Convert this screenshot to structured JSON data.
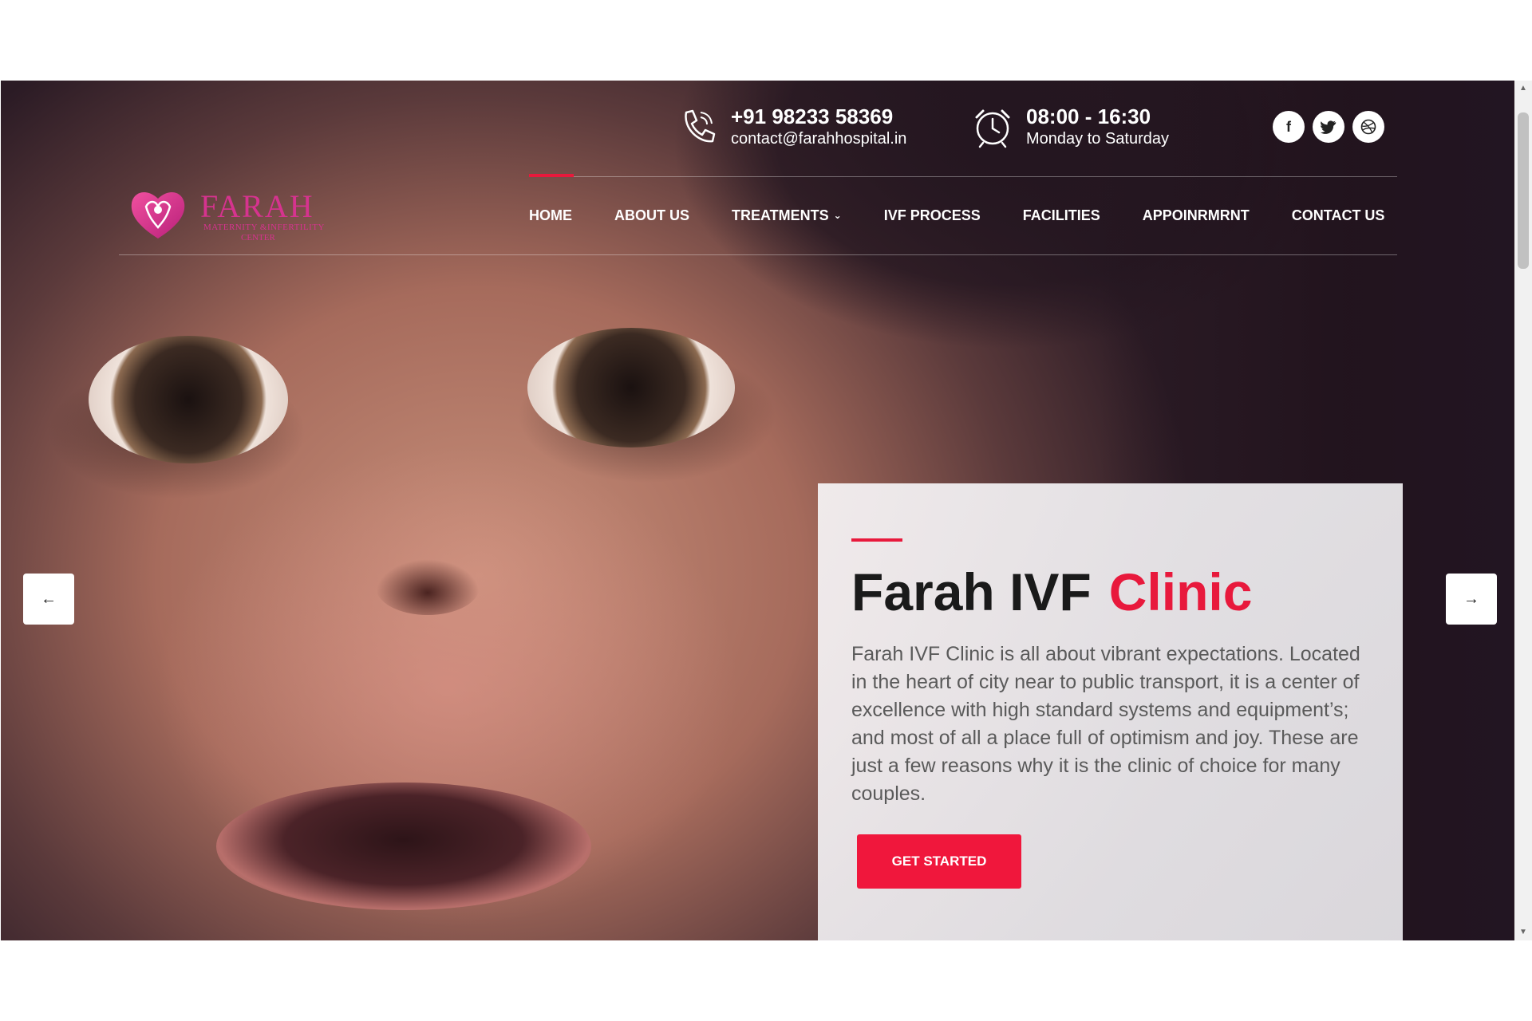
{
  "header": {
    "phone": "+91 98233 58369",
    "email": "contact@farahhospital.in",
    "hours": "08:00 - 16:30",
    "days": "Monday to Saturday",
    "social": [
      {
        "name": "facebook-icon",
        "glyph": "f"
      },
      {
        "name": "twitter-icon",
        "glyph": "t"
      },
      {
        "name": "dribbble-icon",
        "glyph": "◎"
      }
    ]
  },
  "logo": {
    "brand": "FARAH",
    "tagline_1": "MATERNITY &INFERTILITY",
    "tagline_2": "CENTER",
    "color": "#d6338f"
  },
  "nav": {
    "items": [
      {
        "label": "HOME",
        "active": true
      },
      {
        "label": "ABOUT US"
      },
      {
        "label": "TREATMENTS",
        "has_dropdown": true
      },
      {
        "label": "IVF PROCESS"
      },
      {
        "label": "FACILITIES"
      },
      {
        "label": "APPOINRMRNT"
      },
      {
        "label": "CONTACT US"
      }
    ],
    "accent": "#e8193c"
  },
  "slider": {
    "prev_glyph": "←",
    "next_glyph": "→"
  },
  "hero_card": {
    "title_main": "Farah IVF",
    "title_accent": "Clinic",
    "description": "Farah IVF Clinic is all about vibrant expectations. Located in the heart of city near to public transport, it is a center of excellence with high standard systems and equipment’s; and most of all a place full of optimism and joy. These are just a few reasons why it is the clinic of choice for many couples.",
    "cta_label": "GET STARTED",
    "accent": "#e8193c"
  }
}
